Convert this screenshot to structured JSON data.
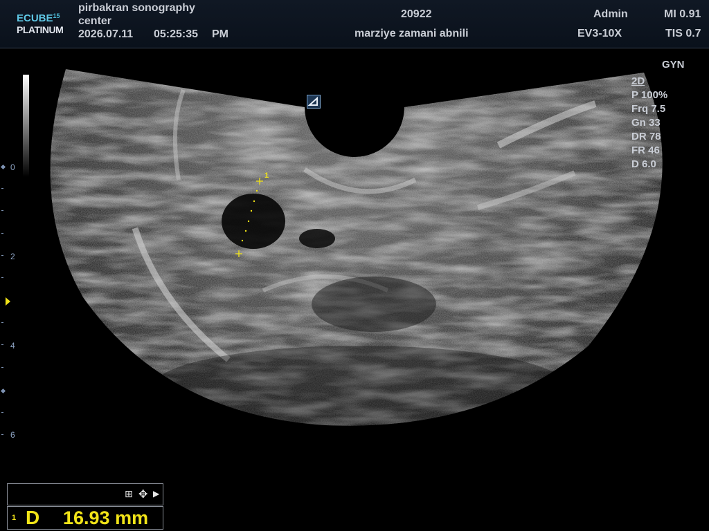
{
  "header": {
    "logo_top": "ECUBE",
    "logo_num": "15",
    "logo_bottom": "PLATINUM",
    "institution": "pirbakran sonography",
    "institution_line2": "center",
    "date": "2026.07.11",
    "time": "05:25:35",
    "ampm": "PM",
    "patient_id": "20922",
    "patient_name": "marziye zamani abnili",
    "operator": "Admin",
    "probe": "EV3-10X",
    "mi": "MI 0.91",
    "tis": "TIS 0.7"
  },
  "preset": "GYN",
  "params": {
    "mode": "2D",
    "power": "P 100%",
    "frequency": "Frq 7.5",
    "gain": "Gn 33",
    "dynamic_range": "DR 78",
    "frame_rate": "FR 46",
    "depth": "D 6.0"
  },
  "depth_scale": {
    "labels": [
      "0",
      "2",
      "4",
      "6"
    ]
  },
  "caliper": {
    "index": "1"
  },
  "measurement": {
    "index": "1",
    "label": "D",
    "value": "16.93 mm"
  },
  "toolbar": {
    "grid_icon": "⊞",
    "move_icon": "✥",
    "next_icon": "▶"
  },
  "colors": {
    "caliper": "#f2e418",
    "header_bg": "#0d1520",
    "logo_accent": "#5fc8e6",
    "depth_scale": "#8fa6c6"
  }
}
